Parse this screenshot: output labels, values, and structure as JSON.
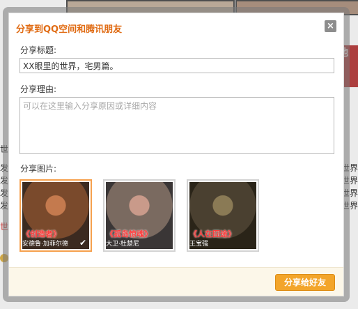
{
  "background": {
    "left_texts": [
      "世",
      "发",
      "发",
      "发",
      "发",
      "世"
    ],
    "right_texts": [
      "世界",
      "世界",
      "世界",
      "世界"
    ],
    "banner_text": "他"
  },
  "dialog": {
    "title": "分享到QQ空间和腾讯朋友",
    "close_label": "×",
    "fields": {
      "title_label": "分享标题:",
      "title_value": "XX眼里的世界，宅男篇。",
      "reason_label": "分享理由:",
      "reason_placeholder": "可以在这里输入分享原因或详细内容",
      "images_label": "分享图片:"
    },
    "images": [
      {
        "caption": "《创造者》",
        "sub": "安德鲁·加菲尔德",
        "selected": true,
        "colors": [
          "#7a4a2c",
          "#c47a4e",
          "#3b2a20"
        ]
      },
      {
        "caption": "《孤岛惊魂》",
        "sub": "大卫·杜楚尼",
        "selected": false,
        "colors": [
          "#7a6a60",
          "#c99a8a",
          "#3a3636"
        ]
      },
      {
        "caption": "《人在囧途》",
        "sub": "王宝强",
        "selected": false,
        "colors": [
          "#4a4030",
          "#8a7a55",
          "#2a2418"
        ]
      }
    ],
    "selected_check": "✔",
    "share_button": "分享给好友"
  }
}
